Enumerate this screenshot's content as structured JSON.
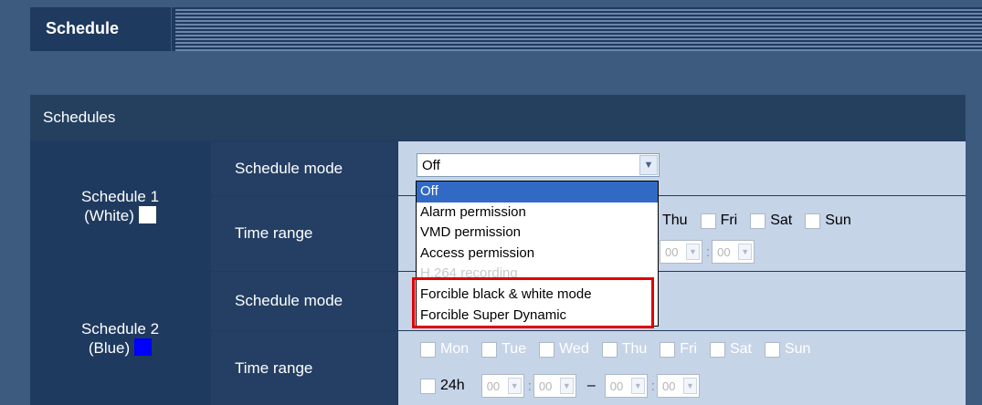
{
  "tab": {
    "title": "Schedule"
  },
  "panel": {
    "title": "Schedules"
  },
  "schedule1": {
    "name": "Schedule 1",
    "color_name": "(White)",
    "swatch_color": "#ffffff",
    "mode_label": "Schedule mode",
    "mode_value": "Off",
    "time_label": "Time range",
    "days_visible": [
      "Thu",
      "Fri",
      "Sat",
      "Sun"
    ],
    "times_visible": [
      "00",
      "00"
    ]
  },
  "schedule2": {
    "name": "Schedule 2",
    "color_name": "(Blue)",
    "swatch_color": "#0000ff",
    "mode_label": "Schedule mode",
    "time_label": "Time range",
    "days": [
      "Mon",
      "Tue",
      "Wed",
      "Thu",
      "Fri",
      "Sat",
      "Sun"
    ],
    "all_day": "24h",
    "times": [
      "00",
      "00",
      "00",
      "00"
    ]
  },
  "dropdown": {
    "options": [
      {
        "label": "Off",
        "selected": true,
        "disabled": false
      },
      {
        "label": "Alarm permission",
        "selected": false,
        "disabled": false
      },
      {
        "label": "VMD permission",
        "selected": false,
        "disabled": false
      },
      {
        "label": "Access permission",
        "selected": false,
        "disabled": false
      },
      {
        "label": "H.264 recording",
        "selected": false,
        "disabled": true
      },
      {
        "label": "Forcible black & white mode",
        "selected": false,
        "disabled": false
      },
      {
        "label": "Forcible Super Dynamic",
        "selected": false,
        "disabled": false
      }
    ]
  },
  "colors": {
    "highlight": "#e00000",
    "selected_option": "#316ac5"
  }
}
